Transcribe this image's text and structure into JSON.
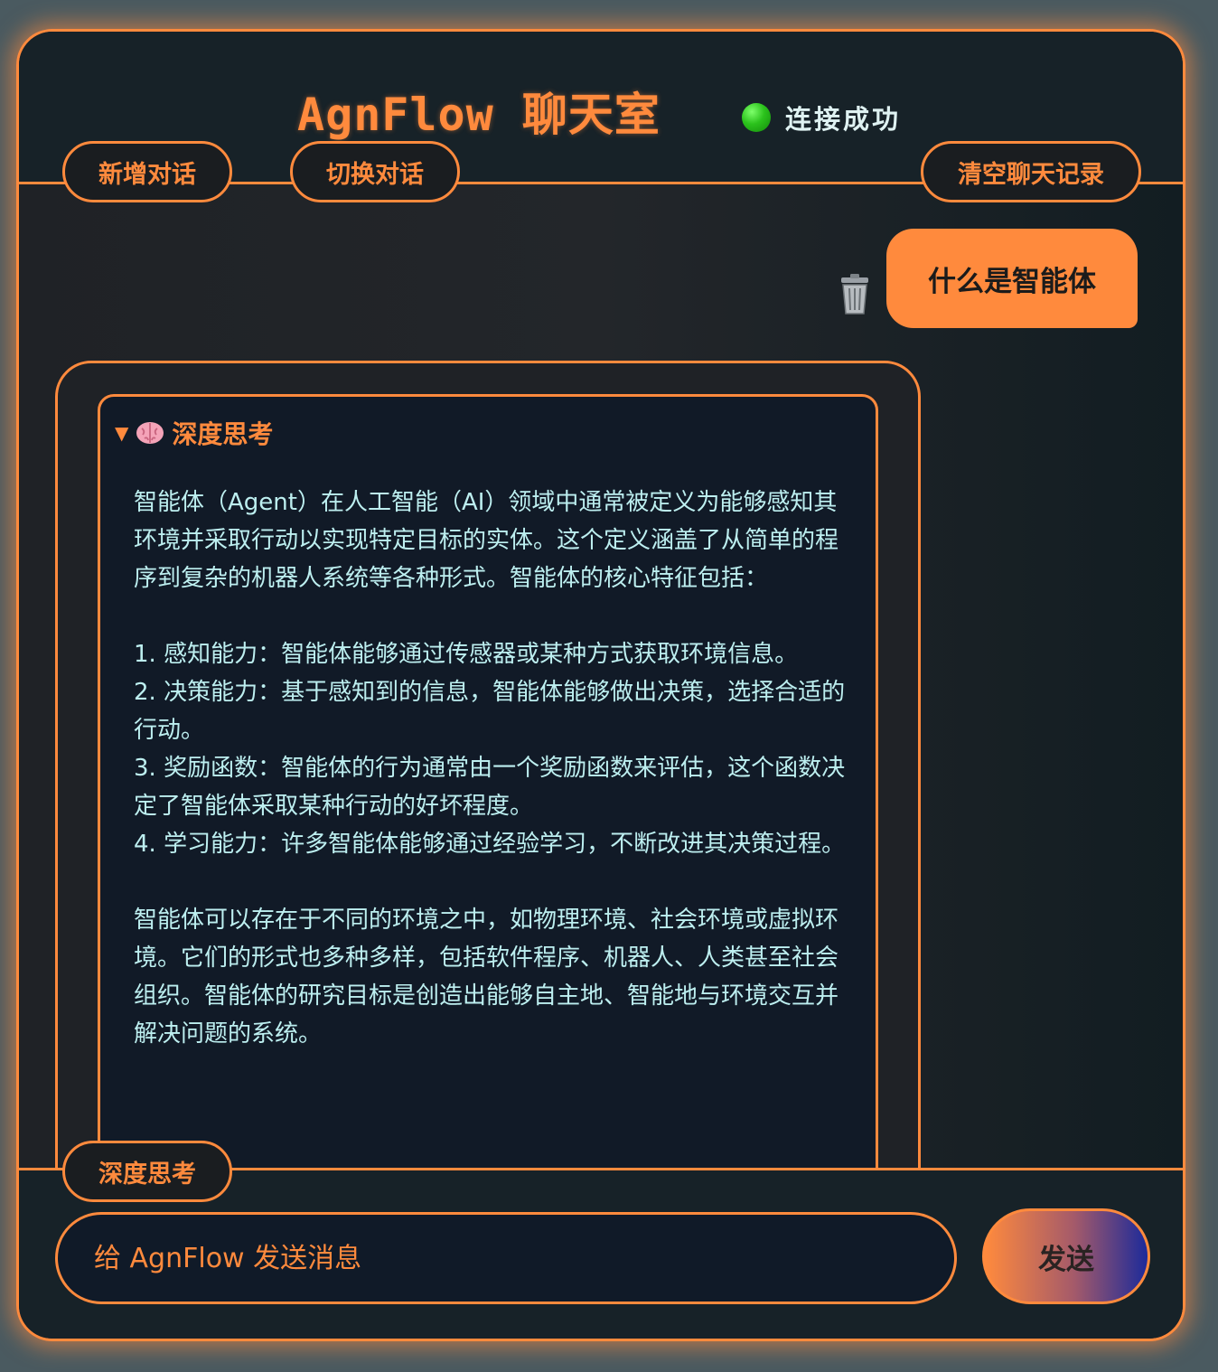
{
  "app": {
    "title": "AgnFlow 聊天室",
    "status_text": "连接成功",
    "accent_color": "#ff8a3d",
    "status_color": "#2bc21c"
  },
  "toolbar": {
    "new_chat": "新增对话",
    "switch_chat": "切换对话",
    "clear_history": "清空聊天记录"
  },
  "messages": {
    "user": {
      "text": "什么是智能体",
      "delete_icon": "trash-icon"
    },
    "assistant": {
      "thinking_label": "深度思考",
      "thinking_toggle_icon": "caret-down-icon",
      "thinking_brain_icon": "brain-icon",
      "thinking_text": "智能体（Agent）在人工智能（AI）领域中通常被定义为能够感知其环境并采取行动以实现特定目标的实体。这个定义涵盖了从简单的程序到复杂的机器人系统等各种形式。智能体的核心特征包括：\n\n1. 感知能力：智能体能够通过传感器或某种方式获取环境信息。\n2. 决策能力：基于感知到的信息，智能体能够做出决策，选择合适的行动。\n3. 奖励函数：智能体的行为通常由一个奖励函数来评估，这个函数决定了智能体采取某种行动的好坏程度。\n4. 学习能力：许多智能体能够通过经验学习，不断改进其决策过程。\n\n智能体可以存在于不同的环境之中，如物理环境、社会环境或虚拟环境。它们的形式也多种多样，包括软件程序、机器人、人类甚至社会组织。智能体的研究目标是创造出能够自主地、智能地与环境交互并解决问题的系统。"
    }
  },
  "composer": {
    "deep_think_toggle": "深度思考",
    "placeholder": "给 AgnFlow 发送消息",
    "value": "",
    "send_label": "发送"
  }
}
